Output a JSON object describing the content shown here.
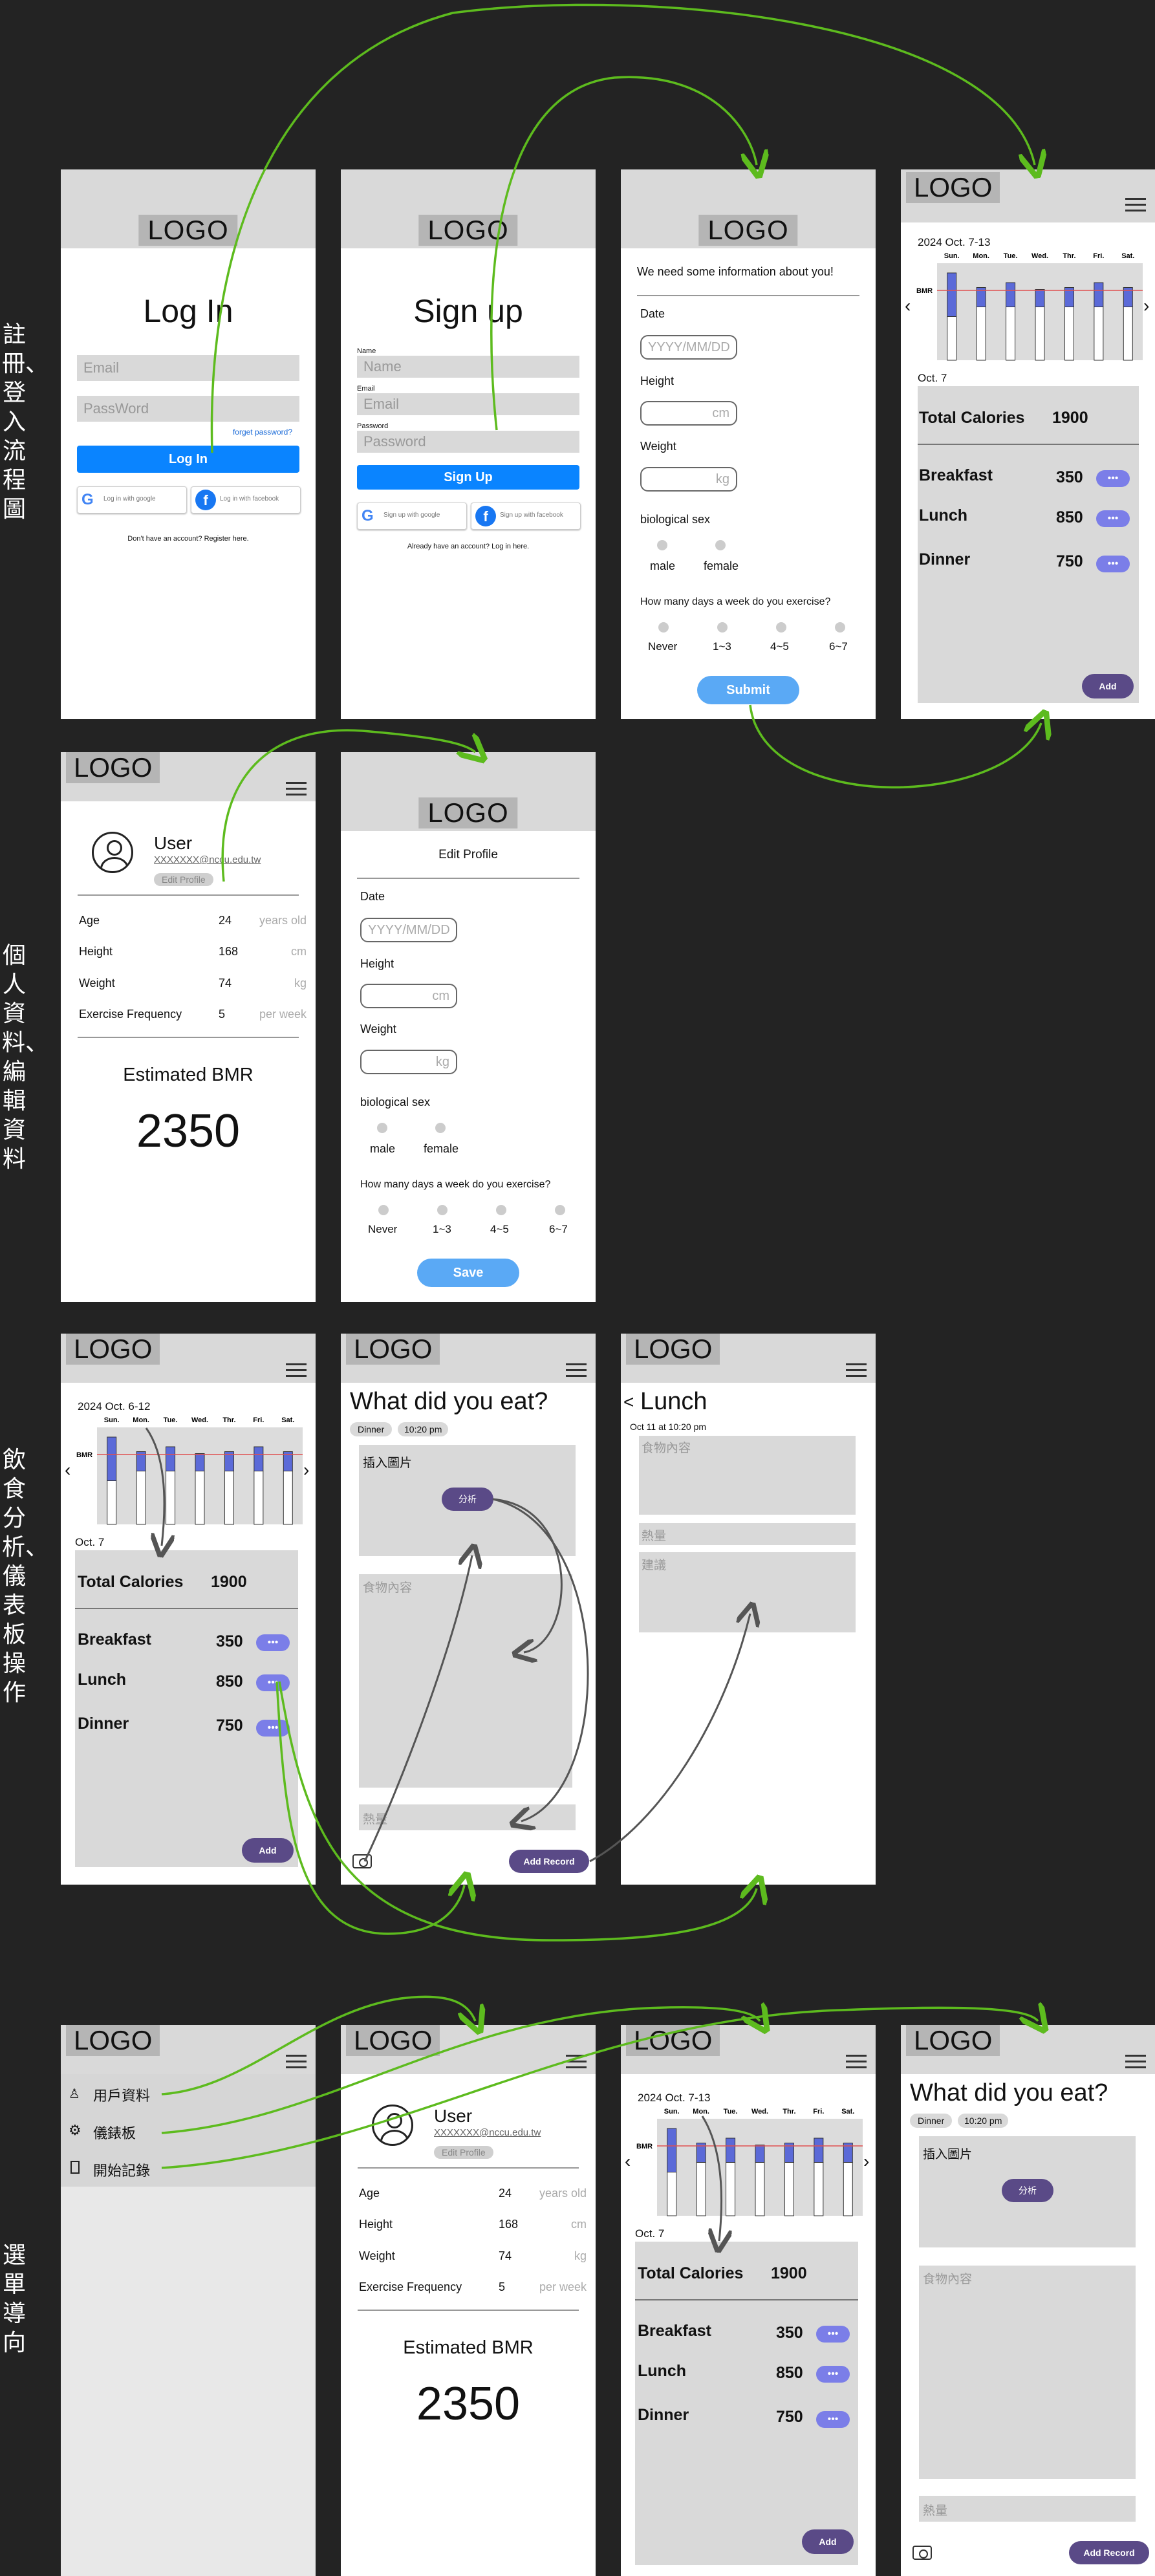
{
  "side_labels": [
    "註冊、登入流程圖",
    "個人資料、編輯資料",
    "飲食分析、儀表板操作",
    "選單導向"
  ],
  "logo": "LOGO",
  "login": {
    "title": "Log In",
    "email_ph": "Email",
    "password_ph": "PassWord",
    "forgot": "forget password?",
    "login_btn": "Log In",
    "google": "Log in with google",
    "facebook": "Log in with facebook",
    "register": "Don't have an account? Register here."
  },
  "signup": {
    "title": "Sign up",
    "name_lbl": "Name",
    "name_ph": "Name",
    "email_lbl": "Email",
    "email_ph": "Email",
    "password_lbl": "Password",
    "password_ph": "Password",
    "signup_btn": "Sign Up",
    "google": "Sign up with google",
    "facebook": "Sign up with facebook",
    "login": "Already have an account? Log in here."
  },
  "info": {
    "heading": "We need some information about you!",
    "date_lbl": "Date",
    "date_ph": "YYYY/MM/DD",
    "height_lbl": "Height",
    "height_unit": "cm",
    "weight_lbl": "Weight",
    "weight_unit": "kg",
    "sex_lbl": "biological sex",
    "male": "male",
    "female": "female",
    "exercise_q": "How many days a week do you exercise?",
    "opts": [
      "Never",
      "1~3",
      "4~5",
      "6~7"
    ],
    "submit": "Submit"
  },
  "edit": {
    "heading": "Edit Profile",
    "save": "Save"
  },
  "dash_a": {
    "week": "2024 Oct. 7-13",
    "day": "Oct. 7"
  },
  "dash_b": {
    "week": "2024 Oct. 6-12",
    "day": "Oct. 7"
  },
  "dash_common": {
    "days": [
      "Sun.",
      "Mon.",
      "Tue.",
      "Wed.",
      "Thr.",
      "Fri.",
      "Sat."
    ],
    "bmr": "BMR",
    "total_lbl": "Total Calories",
    "total_val": "1900",
    "meals": [
      {
        "name": "Breakfast",
        "kcal": "350"
      },
      {
        "name": "Lunch",
        "kcal": "850"
      },
      {
        "name": "Dinner",
        "kcal": "750"
      }
    ],
    "more": "•••",
    "add": "Add",
    "prev": "‹",
    "next": "›"
  },
  "chart_data": {
    "type": "bar",
    "categories": [
      "Sun.",
      "Mon.",
      "Tue.",
      "Wed.",
      "Thr.",
      "Fri.",
      "Sat."
    ],
    "series": [
      {
        "values": [
          0.45,
          0.2,
          0.25,
          0.18,
          0.2,
          0.25,
          0.2
        ]
      },
      {
        "values": [
          0.45,
          0.55,
          0.55,
          0.55,
          0.55,
          0.55,
          0.55
        ]
      }
    ],
    "bmr": 0.72,
    "ylim": [
      0,
      1
    ]
  },
  "profile": {
    "name": "User",
    "email": "XXXXXXX@nccu.edu.tw",
    "edit_btn": "Edit Profile",
    "rows": [
      {
        "label": "Age",
        "value": "24",
        "unit": "years old"
      },
      {
        "label": "Height",
        "value": "168",
        "unit": "cm"
      },
      {
        "label": "Weight",
        "value": "74",
        "unit": "kg"
      },
      {
        "label": "Exercise Frequency",
        "value": "5",
        "unit": "per week"
      }
    ],
    "bmr_lbl": "Estimated BMR",
    "bmr_val": "2350"
  },
  "eat": {
    "title": "What did you eat?",
    "meal_tag": "Dinner",
    "time_tag": "10:20 pm",
    "image_lbl": "插入圖片",
    "analyze": "分析",
    "content_ph": "食物內容",
    "cal_ph": "熱量",
    "add_record": "Add Record"
  },
  "lunch": {
    "title": "Lunch",
    "back": "<",
    "time": "Oct 11 at 10:20 pm",
    "content": "食物內容",
    "cal": "熱量",
    "advice": "建議"
  },
  "menu": {
    "items": [
      "用戶資料",
      "儀錶板",
      "開始記錄"
    ]
  },
  "colors": {
    "blue": "#0a84ff",
    "purple": "#5a4a87",
    "lavender": "#7b7ee8",
    "green": "#5dbb1e",
    "arrow_grey": "#555555",
    "bar_blue": "#5b6ad8"
  }
}
